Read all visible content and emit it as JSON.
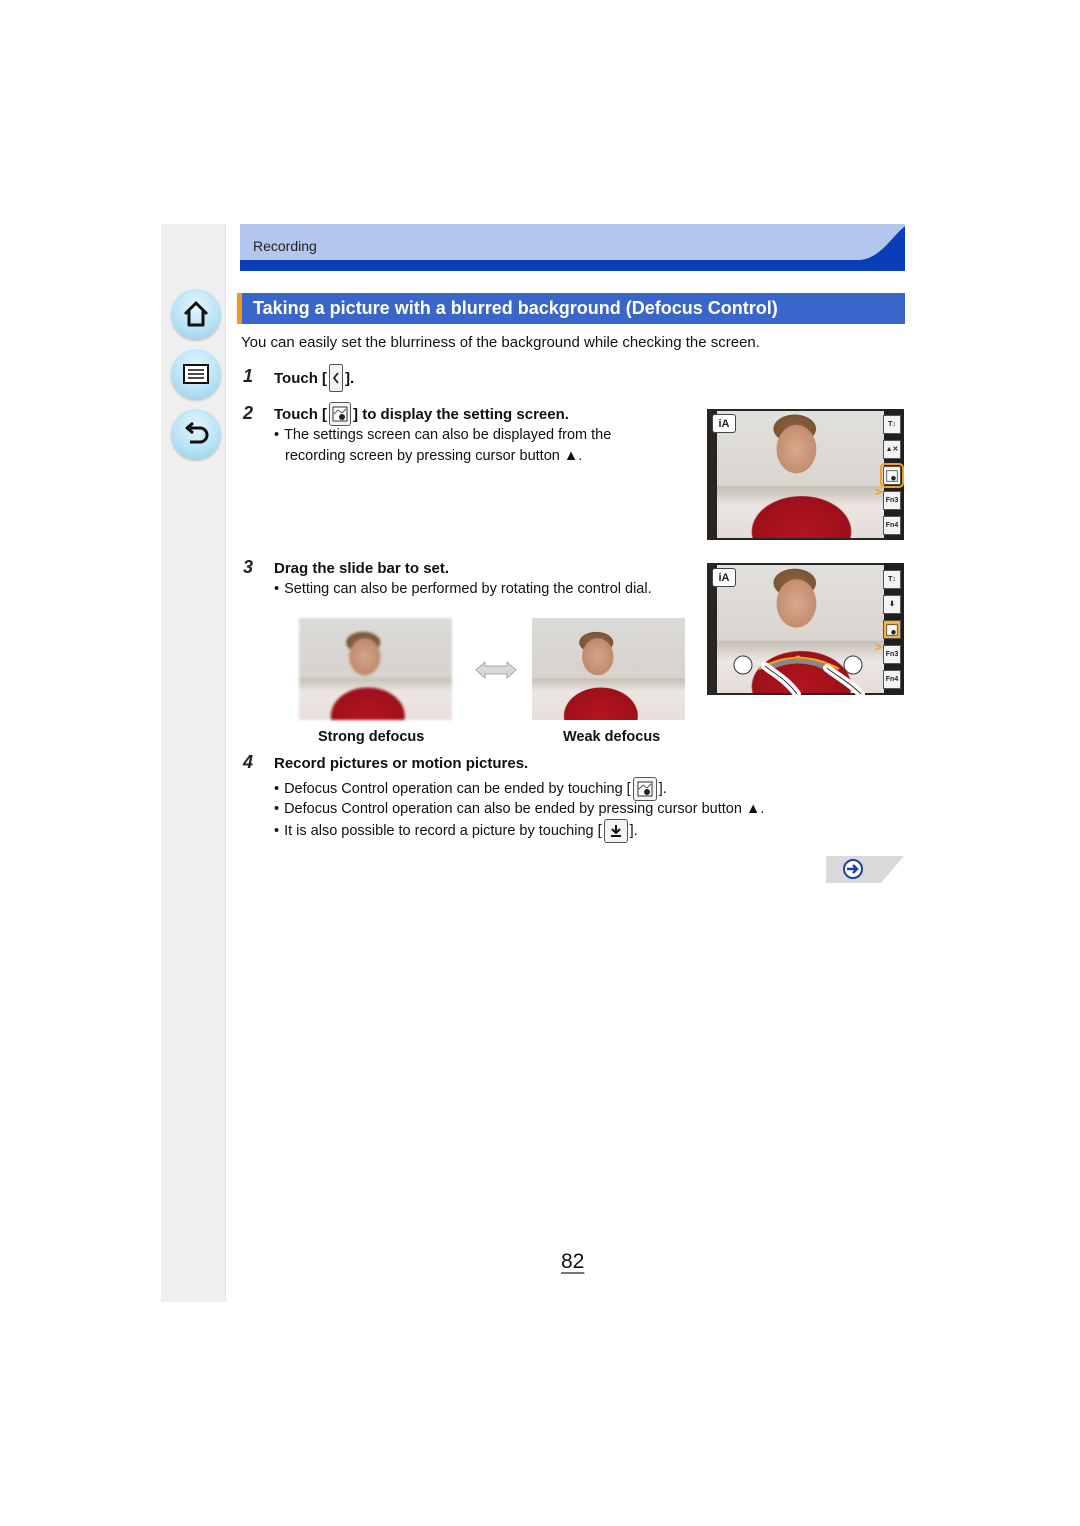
{
  "sidebar": {
    "buttons": [
      {
        "name": "home",
        "icon": "home-icon"
      },
      {
        "name": "contents",
        "icon": "list-icon"
      },
      {
        "name": "back",
        "icon": "return-arrow-icon"
      }
    ]
  },
  "header": {
    "section_label": "Recording"
  },
  "section": {
    "title": "Taking a picture with a blurred background (Defocus Control)",
    "intro": "You can easily set the blurriness of the background while checking the screen."
  },
  "steps": [
    {
      "number": "1",
      "title_before": "Touch [",
      "icon": "tab-open-icon",
      "title_after": "]."
    },
    {
      "number": "2",
      "title_before": "Touch [",
      "icon": "defocus-control-icon",
      "title_after": "] to display the setting screen.",
      "bullets": [
        "The settings screen can also be displayed from the",
        "recording screen by pressing cursor button ▲."
      ]
    },
    {
      "number": "3",
      "title": "Drag the slide bar to set.",
      "bullets": [
        "Setting can also be performed by rotating the control dial."
      ],
      "comparison": {
        "left_label": "Strong defocus",
        "right_label": "Weak defocus",
        "arrow_icon": "double-arrow-icon"
      }
    },
    {
      "number": "4",
      "title": "Record pictures or motion pictures.",
      "bullets": [
        {
          "before": "Defocus Control operation can be ended by touching [",
          "icon": "defocus-control-icon",
          "after": "]."
        },
        {
          "text": "Defocus Control operation can also be ended by pressing cursor button ▲."
        },
        {
          "before": "It is also possible to record a picture by touching [",
          "icon": "shutter-icon",
          "after": "]."
        }
      ]
    }
  ],
  "camera_screens": {
    "mode_badge": "iA",
    "rail_buttons_1": [
      "T W zoom",
      "exposure",
      "defocus",
      "Fn3",
      "Fn4"
    ],
    "rail_buttons_2": [
      "T W zoom",
      "shutter",
      "defocus",
      "Fn3",
      "Fn4"
    ],
    "fn3_label": "Fn3",
    "fn4_label": "Fn4",
    "zoom_T": "T",
    "zoom_W": "W"
  },
  "footer": {
    "page_number": "82",
    "next_icon": "next-page-arrow-icon"
  },
  "colors": {
    "title_bar": "#3a66c9",
    "title_accent": "#f29a1d",
    "header_light": "#b3c6ee",
    "header_dark": "#0a3db8",
    "highlight": "#f0a21a"
  }
}
